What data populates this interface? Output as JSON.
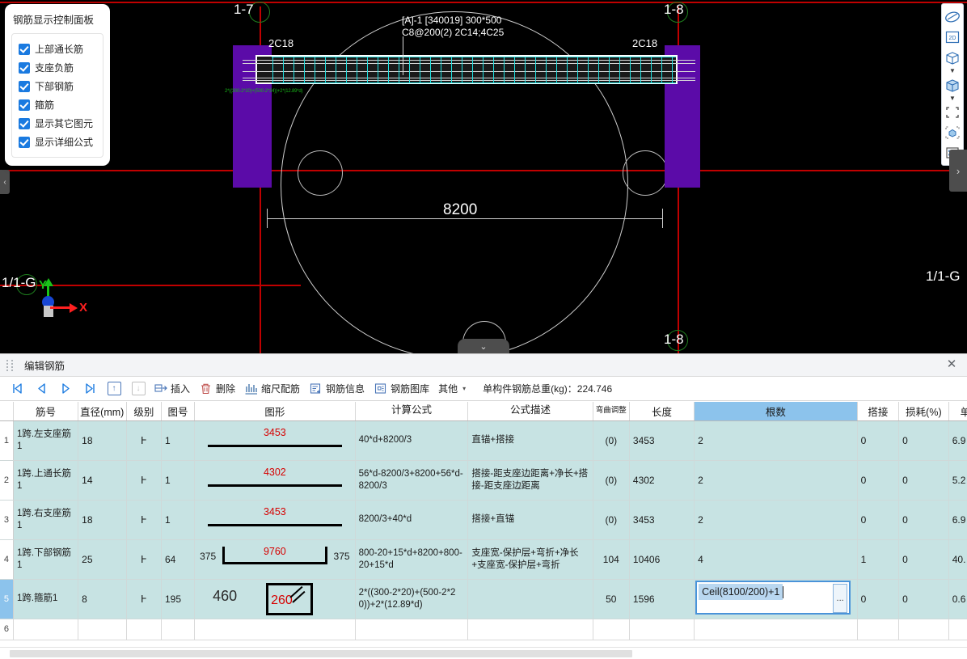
{
  "control_panel": {
    "title": "钢筋显示控制面板",
    "options": [
      {
        "label": "上部通长筋",
        "checked": true
      },
      {
        "label": "支座负筋",
        "checked": true
      },
      {
        "label": "下部钢筋",
        "checked": true
      },
      {
        "label": "箍筋",
        "checked": true
      },
      {
        "label": "显示其它图元",
        "checked": true
      },
      {
        "label": "显示详细公式",
        "checked": true
      }
    ]
  },
  "cad": {
    "beam_label_line1": "[A]-1 [340019] 300*500",
    "beam_label_line2": "C8@200(2) 2C14;4C25",
    "rebar_label_left": "2C18",
    "rebar_label_right": "2C18",
    "dimension": "8200",
    "stirrup_formula": "2*((300-2*20)+(500-2*24))+2*(12.89*d)",
    "axis_top_left": "1-7",
    "axis_top_right": "1-8",
    "axis_bottom_left": "1-8",
    "axis_left": "1/1-G",
    "axis_right": "1/1-G",
    "coord_x": "X",
    "coord_y": "Y",
    "colors": {
      "background": "#000000",
      "grid_axis": "#c00000",
      "column": "#5b0ba8",
      "stirrup": "#21e0e0",
      "rebar": "#ffffff",
      "formula_text": "#17b217"
    }
  },
  "right_toolbar": {
    "items": [
      {
        "name": "orbit-icon",
        "label": "动态观察"
      },
      {
        "name": "view-2d-icon",
        "label": "2D"
      },
      {
        "name": "view-3d-icon",
        "label": "3D"
      },
      {
        "name": "solid-view-icon",
        "label": "实体"
      },
      {
        "name": "select-box-icon",
        "label": "框选"
      },
      {
        "name": "hide-element-icon",
        "label": "隐藏图元"
      },
      {
        "name": "list-view-icon",
        "label": "列表"
      }
    ],
    "flyout": "›",
    "left_handle": "‹",
    "bottom_collapse": "⌄"
  },
  "panel": {
    "title": "编辑钢筋",
    "close": "✕"
  },
  "toolbar": {
    "nav_first": "|◁",
    "nav_prev": "◁",
    "nav_next": "▷",
    "nav_last": "▷|",
    "move_up": "↑",
    "move_down": "↓",
    "insert_label": "插入",
    "delete_label": "删除",
    "scale_label": "缩尺配筋",
    "info_label": "钢筋信息",
    "library_label": "钢筋图库",
    "other_label": "其他",
    "other_caret": "▾",
    "total_weight": "单构件钢筋总重(kg)：224.746"
  },
  "grid": {
    "columns": [
      "筋号",
      "直径(mm)",
      "级别",
      "图号",
      "图形",
      "计算公式",
      "公式描述",
      "弯曲调整",
      "长度",
      "根数",
      "搭接",
      "损耗(%)",
      "单"
    ],
    "selected_column": "根数",
    "rows": [
      {
        "num": "1",
        "name": "1跨.左支座筋1",
        "diameter": "18",
        "level": "Ⱶ",
        "tuhao": "1",
        "shape": {
          "type": "line",
          "value": "3453"
        },
        "formula": "40*d+8200/3",
        "desc": "直锚+搭接",
        "bend": "(0)",
        "length": "3453",
        "count": "2",
        "lap": "0",
        "loss": "0",
        "unit": "6.9"
      },
      {
        "num": "2",
        "name": "1跨.上通长筋1",
        "diameter": "14",
        "level": "Ⱶ",
        "tuhao": "1",
        "shape": {
          "type": "line",
          "value": "4302"
        },
        "formula": "56*d-8200/3+8200+56*d-8200/3",
        "desc": "搭接-距支座边距离+净长+搭接-距支座边距离",
        "bend": "(0)",
        "length": "4302",
        "count": "2",
        "lap": "0",
        "loss": "0",
        "unit": "5.2"
      },
      {
        "num": "3",
        "name": "1跨.右支座筋1",
        "diameter": "18",
        "level": "Ⱶ",
        "tuhao": "1",
        "shape": {
          "type": "line",
          "value": "3453"
        },
        "formula": "8200/3+40*d",
        "desc": "搭接+直锚",
        "bend": "(0)",
        "length": "3453",
        "count": "2",
        "lap": "0",
        "loss": "0",
        "unit": "6.9"
      },
      {
        "num": "4",
        "name": "1跨.下部钢筋1",
        "diameter": "25",
        "level": "Ⱶ",
        "tuhao": "64",
        "shape": {
          "type": "u",
          "left": "375",
          "value": "9760",
          "right": "375"
        },
        "formula": "800-20+15*d+8200+800-20+15*d",
        "desc": "支座宽-保护层+弯折+净长+支座宽-保护层+弯折",
        "bend": "104",
        "length": "10406",
        "count": "4",
        "lap": "1",
        "loss": "0",
        "unit": "40."
      },
      {
        "num": "5",
        "name": "1跨.箍筋1",
        "diameter": "8",
        "level": "Ⱶ",
        "tuhao": "195",
        "shape": {
          "type": "stirrup",
          "left": "460",
          "value": "260"
        },
        "formula": "2*((300-2*20)+(500-2*20))+2*(12.89*d)",
        "desc": "",
        "bend": "50",
        "length": "1596",
        "count": "",
        "lap": "0",
        "loss": "0",
        "unit": "0.6",
        "active": true,
        "editing_cell": {
          "value": "Ceil(8100/200)+1",
          "ellipsis": "..."
        }
      },
      {
        "num": "6",
        "name": "",
        "diameter": "",
        "level": "",
        "tuhao": "",
        "formula": "",
        "desc": "",
        "bend": "",
        "length": "",
        "count": "",
        "lap": "",
        "loss": "",
        "unit": "",
        "empty": true
      }
    ]
  }
}
